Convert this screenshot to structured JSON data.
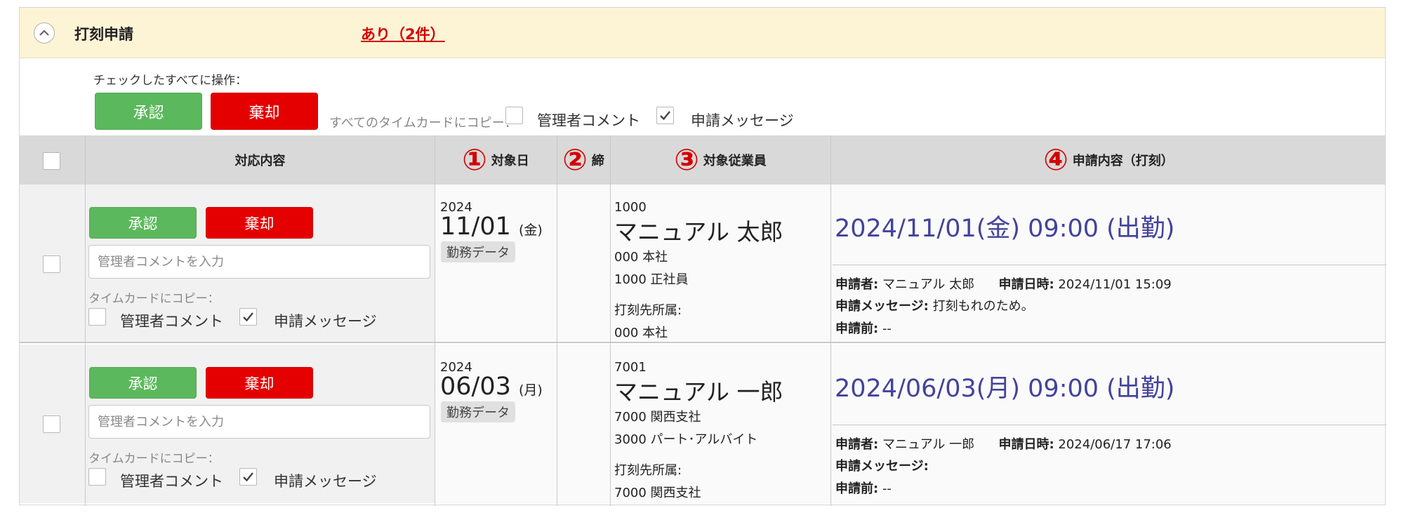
{
  "panel": {
    "title": "打刻申請",
    "pending": "あり（2件）"
  },
  "bulk": {
    "label": "チェックしたすべてに操作：",
    "approve": "承認",
    "reject": "棄却",
    "copy_all_label": "すべてのタイムカードにコピー：",
    "copy_options": [
      {
        "label": "管理者コメント",
        "checked": false
      },
      {
        "label": "申請メッセージ",
        "checked": true
      }
    ]
  },
  "table": {
    "headers": {
      "action": "対応内容",
      "date": "対象日",
      "date_marker": "①",
      "close": "締",
      "close_marker": "②",
      "employee": "対象従業員",
      "employee_marker": "③",
      "request": "申請内容（打刻）",
      "request_marker": "④"
    },
    "rows": [
      {
        "approve": "承認",
        "reject": "棄却",
        "comment_placeholder": "管理者コメントを入力",
        "copy_label": "タイムカードにコピー：",
        "copy_admin": "管理者コメント",
        "copy_message": "申請メッセージ",
        "copy_message_checked": true,
        "year": "2024",
        "date": "11/01",
        "weekday": "(金)",
        "badge": "勤務データ",
        "emp_code": "1000",
        "emp_name": "マニュアル 太郎",
        "dept": "000 本社",
        "type": "1000 正社員",
        "stamp_label": "打刻先所属:",
        "stamp_dept": "000  本社",
        "request_main": "2024/11/01(金) 09:00 (出勤)",
        "applicant_label": "申請者:",
        "applicant": "マニュアル 太郎",
        "applied_at_label": "申請日時:",
        "applied_at": "2024/11/01 15:09",
        "message_label": "申請メッセージ:",
        "message": "打刻もれのため。",
        "before_label": "申請前:",
        "before": "--"
      },
      {
        "approve": "承認",
        "reject": "棄却",
        "comment_placeholder": "管理者コメントを入力",
        "copy_label": "タイムカードにコピー：",
        "copy_admin": "管理者コメント",
        "copy_message": "申請メッセージ",
        "copy_message_checked": true,
        "year": "2024",
        "date": "06/03",
        "weekday": "(月)",
        "badge": "勤務データ",
        "emp_code": "7001",
        "emp_name": "マニュアル 一郎",
        "dept": "7000 関西支社",
        "type": "3000 パート･アルバイト",
        "stamp_label": "打刻先所属:",
        "stamp_dept": "7000  関西支社",
        "request_main": "2024/06/03(月) 09:00 (出勤)",
        "applicant_label": "申請者:",
        "applicant": "マニュアル 一郎",
        "applied_at_label": "申請日時:",
        "applied_at": "2024/06/17 17:06",
        "message_label": "申請メッセージ:",
        "message": "",
        "before_label": "申請前:",
        "before": "--"
      }
    ]
  },
  "colors": {
    "approve": "#5cb85c",
    "reject": "#e50000",
    "header_bg": "#fdf4d6",
    "pending": "#d40000",
    "marker": "#d40000",
    "request_text": "#43439a"
  },
  "icons": {
    "collapse": "chevron-up-icon",
    "check": "checkmark-icon"
  }
}
